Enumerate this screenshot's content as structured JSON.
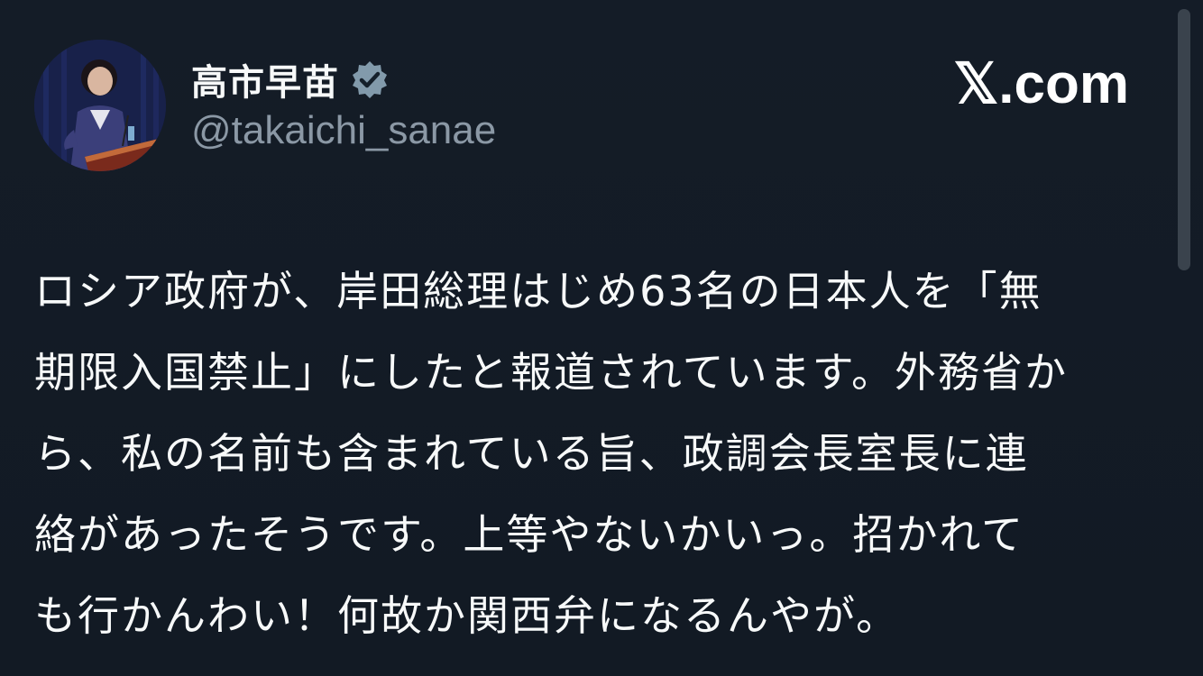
{
  "author": {
    "display_name": "高市早苗",
    "handle": "@takaichi_sanae",
    "verified": true,
    "avatar_icon": "profile-photo"
  },
  "site": {
    "label": "𝕏.com"
  },
  "tweet": {
    "lines": [
      "ロシア政府が、岸田総理はじめ63名の日本人を「無",
      "期限入国禁止」にしたと報道されています。外務省か",
      "ら、私の名前も含まれている旨、政調会長室長に連",
      "絡があったそうです。上等やないかいっ。招かれて",
      "も行かんわい！何故か関西弁になるんやが。"
    ]
  },
  "colors": {
    "background": "#141c27",
    "text": "#f7f9f9",
    "secondary_text": "#8b98a5",
    "verified_badge": "#829aab"
  }
}
